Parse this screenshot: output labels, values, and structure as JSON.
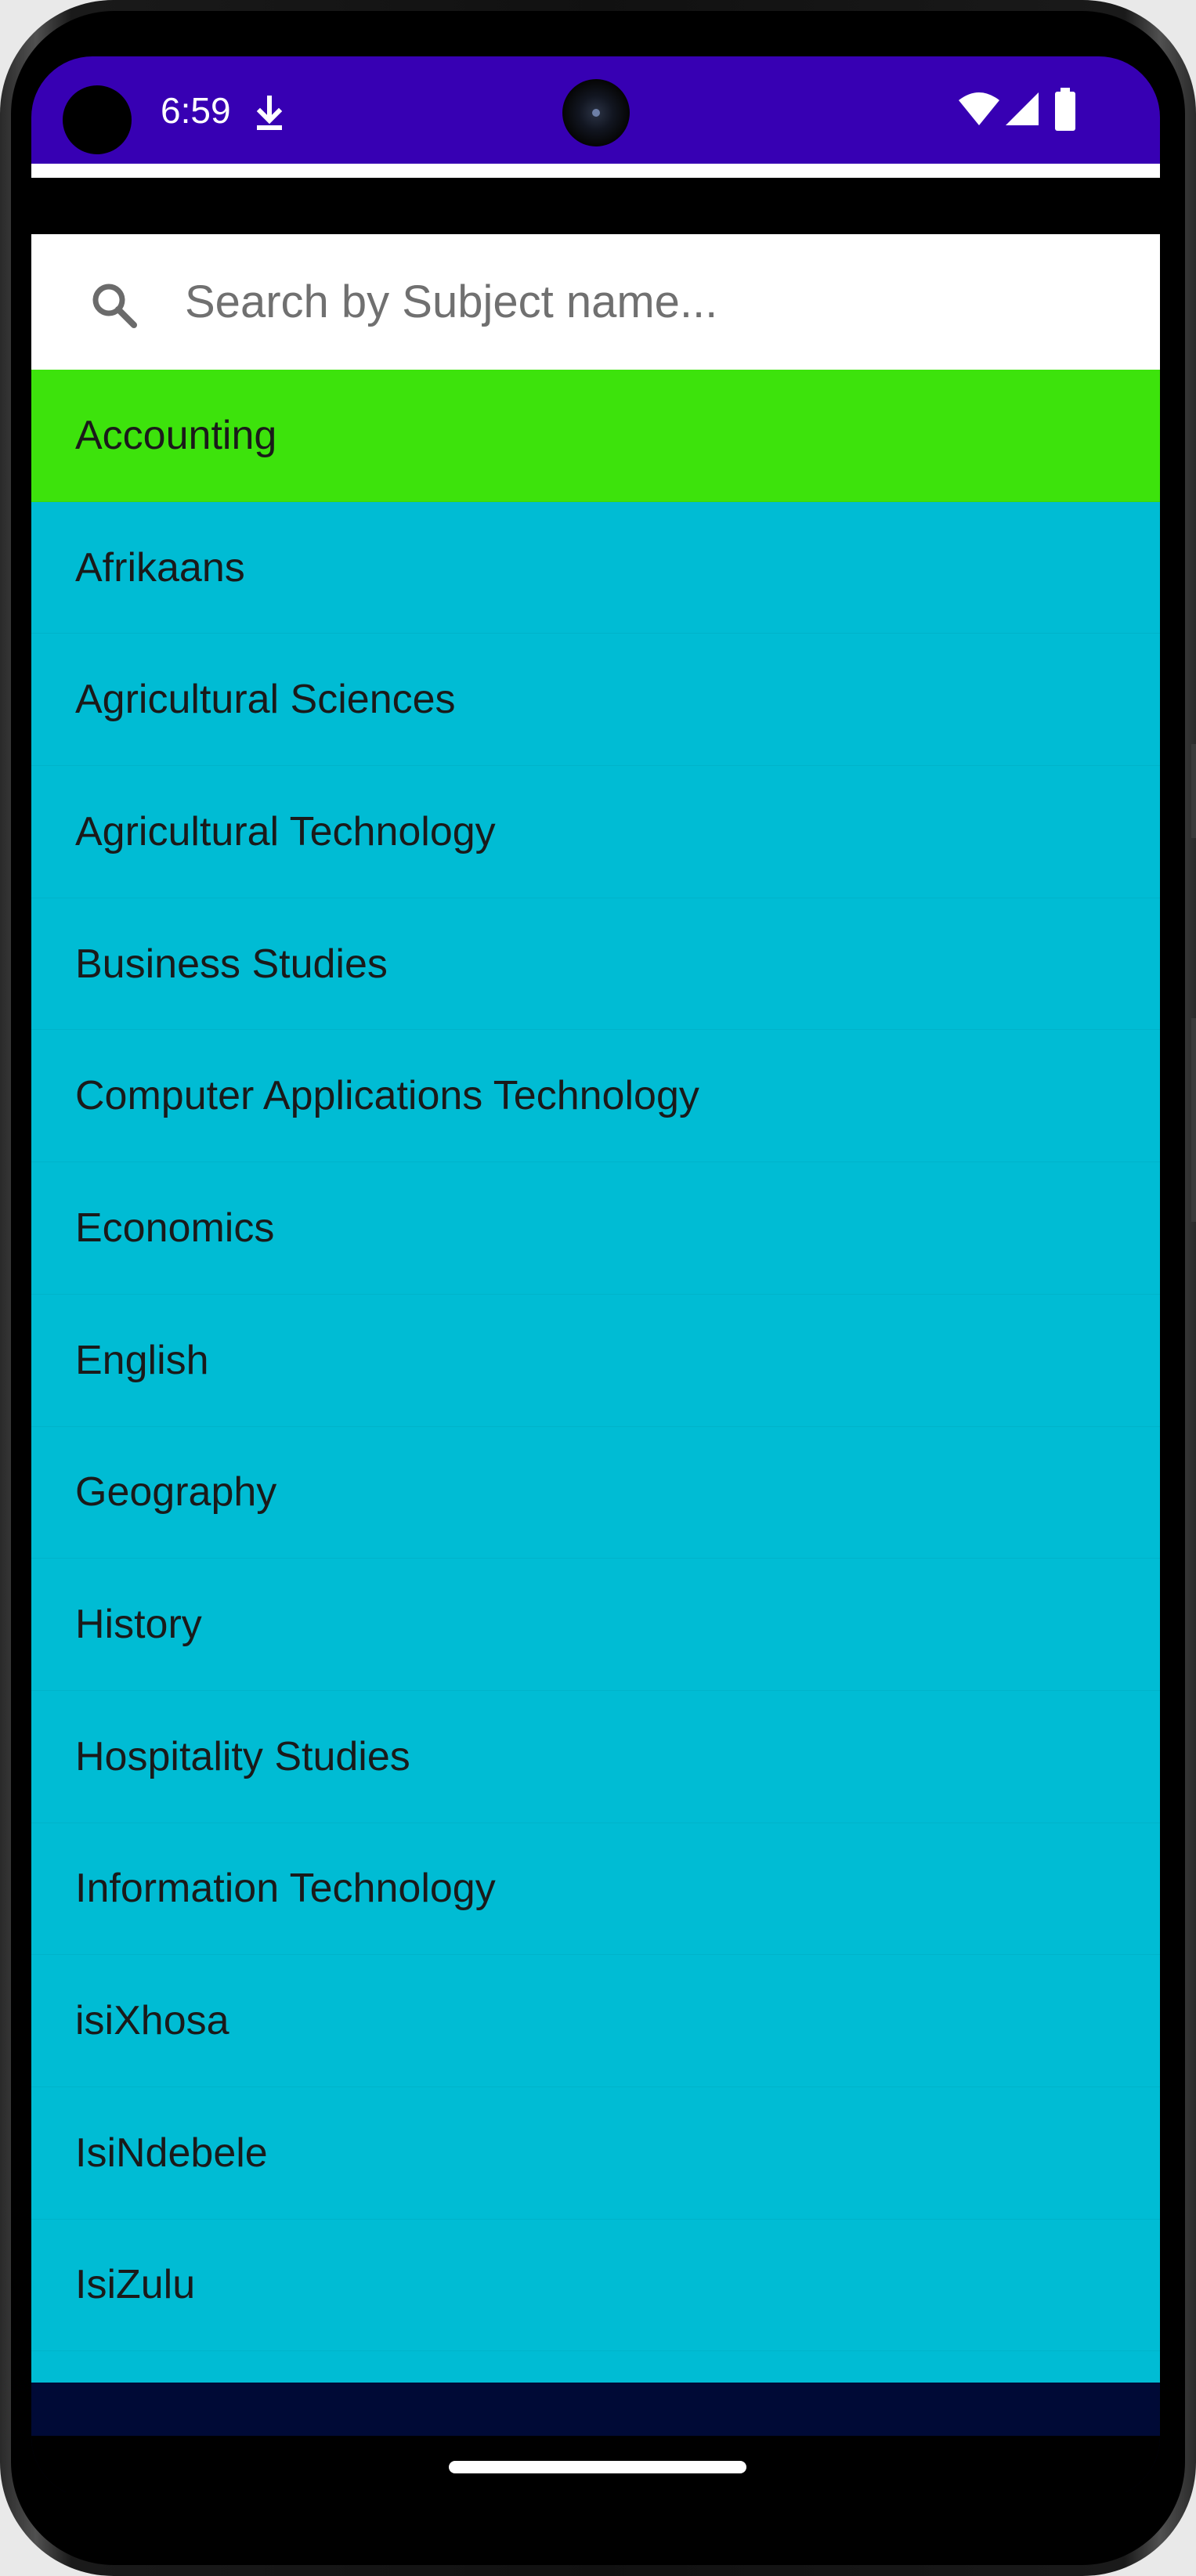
{
  "status_bar": {
    "time": "6:59",
    "icons": [
      "download-icon",
      "wifi-icon",
      "cellular-signal-icon",
      "battery-icon"
    ],
    "color": "#3700b3"
  },
  "search": {
    "placeholder": "Search by Subject name...",
    "value": "",
    "icon": "search-icon"
  },
  "subjects": {
    "selected_color": "#3de30c",
    "list_color": "#00bcd4",
    "items": [
      {
        "label": "Accounting",
        "selected": true
      },
      {
        "label": "Afrikaans",
        "selected": false
      },
      {
        "label": "Agricultural Sciences",
        "selected": false
      },
      {
        "label": "Agricultural Technology",
        "selected": false
      },
      {
        "label": "Business Studies",
        "selected": false
      },
      {
        "label": "Computer Applications Technology",
        "selected": false
      },
      {
        "label": "Economics",
        "selected": false
      },
      {
        "label": "English",
        "selected": false
      },
      {
        "label": "Geography",
        "selected": false
      },
      {
        "label": "History",
        "selected": false
      },
      {
        "label": "Hospitality Studies",
        "selected": false
      },
      {
        "label": "Information Technology",
        "selected": false
      },
      {
        "label": "isiXhosa",
        "selected": false
      },
      {
        "label": "IsiNdebele",
        "selected": false
      },
      {
        "label": "IsiZulu",
        "selected": false
      }
    ]
  },
  "bottom_band": {
    "color": "#000a36"
  }
}
